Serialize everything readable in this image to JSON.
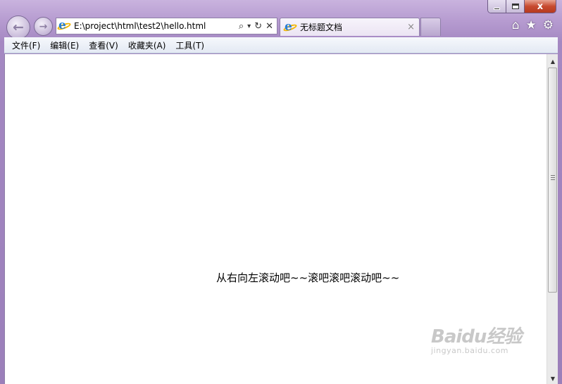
{
  "window": {
    "minimize_icon": "minimize-icon",
    "maximize_icon": "maximize-icon",
    "close_label": "x"
  },
  "nav": {
    "back_glyph": "←",
    "forward_glyph": "→"
  },
  "address_bar": {
    "url": "E:\\project\\html\\test2\\hello.html",
    "search_glyph": "⌕",
    "dropdown_glyph": "▾",
    "refresh_glyph": "↻",
    "stop_glyph": "✕"
  },
  "tab": {
    "title": "无标题文档",
    "close_glyph": "×"
  },
  "toolbar": {
    "home_glyph": "⌂",
    "favorites_glyph": "★",
    "tools_glyph": "⚙"
  },
  "menu": [
    {
      "label": "文件(F)"
    },
    {
      "label": "编辑(E)"
    },
    {
      "label": "查看(V)"
    },
    {
      "label": "收藏夹(A)"
    },
    {
      "label": "工具(T)"
    }
  ],
  "page": {
    "marquee_text": "从右向左滚动吧~~滚吧滚吧滚动吧~~"
  },
  "scrollbar": {
    "up_glyph": "▲",
    "down_glyph": "▼"
  },
  "watermark": {
    "logo": "Baidu经验",
    "sub": "jingyan.baidu.com"
  },
  "colors": {
    "frame": "#a98cc4",
    "menubar": "#e8edf5",
    "content": "#ffffff",
    "close_button": "#c74a2f"
  }
}
